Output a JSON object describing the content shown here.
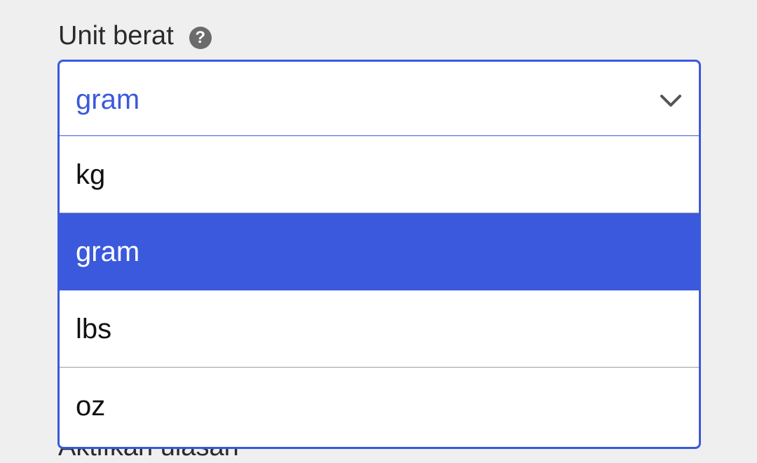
{
  "field": {
    "label": "Unit berat",
    "help_icon_glyph": "?",
    "help_icon_name": "question-icon"
  },
  "select": {
    "current_value": "gram",
    "chevron_icon": "chevron-down-icon"
  },
  "options": [
    {
      "label": "kg",
      "selected": false
    },
    {
      "label": "gram",
      "selected": true
    },
    {
      "label": "lbs",
      "selected": false
    },
    {
      "label": "oz",
      "selected": false
    }
  ],
  "next_field": {
    "label": "Aktifkan ulasan"
  },
  "colors": {
    "accent": "#3a59dd",
    "background": "#efefef",
    "text": "#2a2a2a",
    "help_icon_bg": "#6b6b6b"
  }
}
